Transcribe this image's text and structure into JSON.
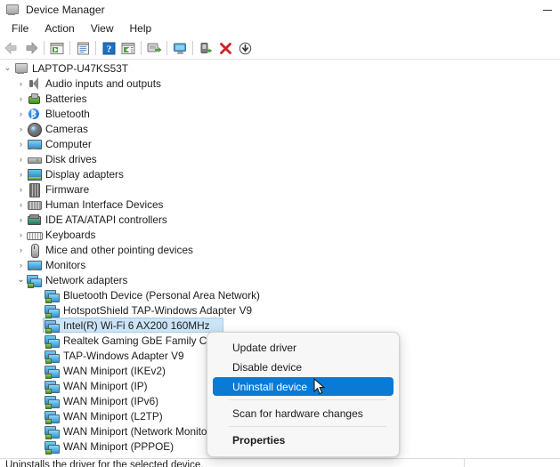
{
  "window": {
    "title": "Device Manager",
    "icon": "device-manager-icon",
    "minimize_label": "—"
  },
  "menubar": {
    "items": [
      {
        "label": "File",
        "name": "menu-file"
      },
      {
        "label": "Action",
        "name": "menu-action"
      },
      {
        "label": "View",
        "name": "menu-view"
      },
      {
        "label": "Help",
        "name": "menu-help"
      }
    ]
  },
  "toolbar": {
    "buttons": [
      {
        "name": "back-button",
        "icon": "arrow-left-icon",
        "tooltip": "Back",
        "disabled": true
      },
      {
        "name": "forward-button",
        "icon": "arrow-right-icon",
        "tooltip": "Forward",
        "disabled": false
      },
      {
        "name": "show-hide-console-tree-button",
        "icon": "console-tree-icon",
        "tooltip": "Show/Hide Console Tree"
      },
      {
        "name": "properties-button",
        "icon": "properties-icon",
        "tooltip": "Properties"
      },
      {
        "name": "help-button",
        "icon": "help-question-icon",
        "tooltip": "Help"
      },
      {
        "name": "view-button",
        "icon": "view-list-icon",
        "tooltip": "View"
      },
      {
        "name": "scan-hardware-changes-button",
        "icon": "scan-hardware-icon",
        "tooltip": "Scan for hardware changes"
      },
      {
        "name": "show-hidden-devices-button",
        "icon": "monitor-icon",
        "tooltip": "Show hidden devices"
      },
      {
        "name": "update-driver-button",
        "icon": "update-driver-icon",
        "tooltip": "Update driver"
      },
      {
        "name": "uninstall-device-button",
        "icon": "red-x-icon",
        "tooltip": "Uninstall device"
      },
      {
        "name": "disable-device-button",
        "icon": "down-arrow-circle-icon",
        "tooltip": "Disable device"
      }
    ]
  },
  "tree": {
    "root": {
      "label": "LAPTOP-U47KS53T",
      "icon": "computer-icon",
      "expander": "⌄",
      "expanded": true
    },
    "categories": [
      {
        "label": "Audio inputs and outputs",
        "icon": "ic-speaker",
        "icon_name": "speaker-icon",
        "expanded": false
      },
      {
        "label": "Batteries",
        "icon": "ic-battery",
        "icon_name": "battery-icon",
        "expanded": false
      },
      {
        "label": "Bluetooth",
        "icon": "ic-bt",
        "icon_name": "bluetooth-icon",
        "expanded": false
      },
      {
        "label": "Cameras",
        "icon": "ic-cam",
        "icon_name": "camera-icon",
        "expanded": false
      },
      {
        "label": "Computer",
        "icon": "ic-monitor",
        "icon_name": "computer-icon",
        "expanded": false
      },
      {
        "label": "Disk drives",
        "icon": "ic-disk",
        "icon_name": "disk-drive-icon",
        "expanded": false
      },
      {
        "label": "Display adapters",
        "icon": "ic-display",
        "icon_name": "display-adapter-icon",
        "expanded": false
      },
      {
        "label": "Firmware",
        "icon": "ic-firmware",
        "icon_name": "firmware-icon",
        "expanded": false
      },
      {
        "label": "Human Interface Devices",
        "icon": "ic-hid",
        "icon_name": "hid-icon",
        "expanded": false
      },
      {
        "label": "IDE ATA/ATAPI controllers",
        "icon": "ic-ide",
        "icon_name": "ide-controller-icon",
        "expanded": false
      },
      {
        "label": "Keyboards",
        "icon": "ic-keyboard",
        "icon_name": "keyboard-icon",
        "expanded": false
      },
      {
        "label": "Mice and other pointing devices",
        "icon": "ic-mouse",
        "icon_name": "mouse-icon",
        "expanded": false
      },
      {
        "label": "Monitors",
        "icon": "ic-monitor",
        "icon_name": "monitor-icon",
        "expanded": false
      },
      {
        "label": "Network adapters",
        "icon": "ic-netadapter",
        "icon_name": "network-adapter-icon",
        "expanded": true
      }
    ],
    "network_devices": [
      {
        "label": "Bluetooth Device (Personal Area Network)",
        "selected": false
      },
      {
        "label": "HotspotShield TAP-Windows Adapter V9",
        "selected": false
      },
      {
        "label": "Intel(R) Wi-Fi 6 AX200 160MHz",
        "selected": true
      },
      {
        "label": "Realtek Gaming GbE Family Controller",
        "selected": false
      },
      {
        "label": "TAP-Windows Adapter V9",
        "selected": false
      },
      {
        "label": "WAN Miniport (IKEv2)",
        "selected": false
      },
      {
        "label": "WAN Miniport (IP)",
        "selected": false
      },
      {
        "label": "WAN Miniport (IPv6)",
        "selected": false
      },
      {
        "label": "WAN Miniport (L2TP)",
        "selected": false
      },
      {
        "label": "WAN Miniport (Network Monitor)",
        "selected": false
      },
      {
        "label": "WAN Miniport (PPPOE)",
        "selected": false
      }
    ],
    "expander_collapsed": "›",
    "expander_expanded": "⌄",
    "selection_color": "#cce4f7"
  },
  "context_menu": {
    "items": [
      {
        "label": "Update driver",
        "name": "ctx-update-driver",
        "highlighted": false,
        "bold": false
      },
      {
        "label": "Disable device",
        "name": "ctx-disable-device",
        "highlighted": false,
        "bold": false
      },
      {
        "label": "Uninstall device",
        "name": "ctx-uninstall-device",
        "highlighted": true,
        "bold": false
      },
      {
        "separator": true
      },
      {
        "label": "Scan for hardware changes",
        "name": "ctx-scan-hardware-changes",
        "highlighted": false,
        "bold": false
      },
      {
        "separator": true
      },
      {
        "label": "Properties",
        "name": "ctx-properties",
        "highlighted": false,
        "bold": true
      }
    ],
    "highlight_color": "#0a7ad4",
    "background_color": "#f7f7f7"
  },
  "statusbar": {
    "text": "Uninstalls the driver for the selected device."
  }
}
